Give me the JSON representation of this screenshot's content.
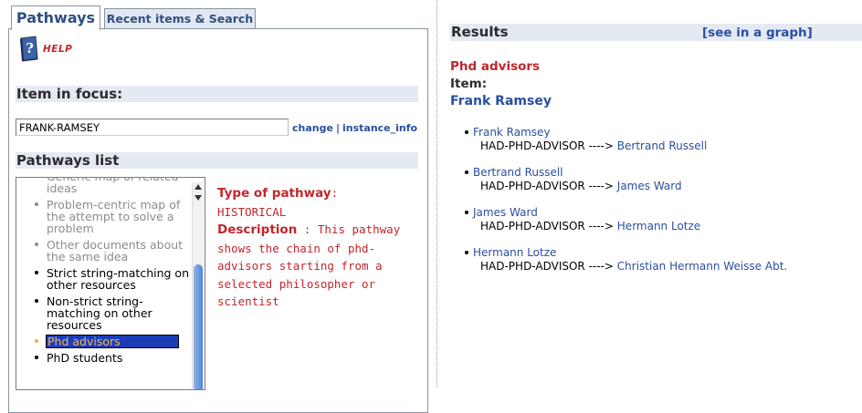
{
  "tabs": [
    {
      "label": "Pathways",
      "active": true
    },
    {
      "label": "Recent items & Search",
      "active": false
    }
  ],
  "help": {
    "label": "HELP",
    "icon": "help-book-icon"
  },
  "focus": {
    "heading": "Item in focus:",
    "value": "FRANK-RAMSEY",
    "links": {
      "change": "change",
      "sep": "|",
      "instance_info": "instance_info"
    }
  },
  "pathways": {
    "heading": "Pathways list",
    "items": [
      {
        "label": "Generic map of related ideas",
        "state": "dimmed"
      },
      {
        "label": "Problem-centric map of the attempt to solve a problem",
        "state": "dimmed"
      },
      {
        "label": "Other documents about the same idea",
        "state": "dimmed"
      },
      {
        "label": "Strict string-matching on other resources",
        "state": "normal"
      },
      {
        "label": "Non-strict string-matching on other resources",
        "state": "normal"
      },
      {
        "label": "Phd advisors",
        "state": "selected"
      },
      {
        "label": "PhD students",
        "state": "normal"
      }
    ],
    "info": {
      "type_label": "Type of pathway",
      "type_value": "HISTORICAL",
      "desc_label": "Description",
      "desc_value": "This pathway shows the chain of phd-advisors starting from a selected philosopher or scientist"
    }
  },
  "results": {
    "heading": "Results",
    "graph_link": "[see in a graph]",
    "title": "Phd advisors",
    "item_label": "Item:",
    "item_value": "Frank Ramsey",
    "rows": [
      {
        "subject": "Frank Ramsey",
        "relation": "HAD-PHD-ADVISOR ---->",
        "object": "Bertrand Russell"
      },
      {
        "subject": "Bertrand Russell",
        "relation": "HAD-PHD-ADVISOR ---->",
        "object": "James Ward"
      },
      {
        "subject": "James Ward",
        "relation": "HAD-PHD-ADVISOR ---->",
        "object": "Hermann Lotze"
      },
      {
        "subject": "Hermann Lotze",
        "relation": "HAD-PHD-ADVISOR ---->",
        "object": "Christian Hermann Weisse Abt."
      }
    ]
  },
  "colors": {
    "accent_red": "#c0262c",
    "link_blue": "#2a4fa0",
    "header_bg": "#e5e9f2",
    "selection_bg": "#1c3db8",
    "selection_text": "#f5b84a"
  }
}
